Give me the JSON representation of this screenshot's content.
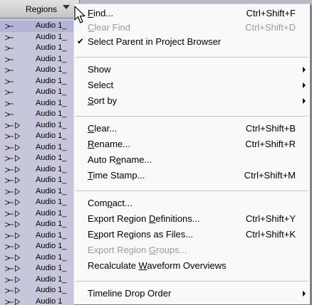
{
  "regions_panel": {
    "header_label": "Regions",
    "rows": [
      {
        "label": "Audio 1_",
        "selected": true
      },
      {
        "label": "Audio 1_",
        "selected": false
      },
      {
        "label": "Audio 1_",
        "selected": false
      },
      {
        "label": "Audio 1_",
        "selected": false
      },
      {
        "label": "Audio 1_",
        "selected": false
      },
      {
        "label": "Audio 1_",
        "selected": false
      },
      {
        "label": "Audio 1_",
        "selected": false
      },
      {
        "label": "Audio 1_",
        "selected": false
      },
      {
        "label": "Audio 1_",
        "selected": false
      },
      {
        "label": "Audio 1_",
        "selected": false
      },
      {
        "label": "Audio 1_",
        "selected": false
      },
      {
        "label": "Audio 1_",
        "selected": false
      },
      {
        "label": "Audio 1_",
        "selected": false
      },
      {
        "label": "Audio 1_",
        "selected": false
      },
      {
        "label": "Audio 1_",
        "selected": false
      },
      {
        "label": "Audio 1_",
        "selected": false
      },
      {
        "label": "Audio 1_",
        "selected": false
      },
      {
        "label": "Audio 1_",
        "selected": false
      },
      {
        "label": "Audio 1_",
        "selected": false
      },
      {
        "label": "Audio 1_",
        "selected": false
      },
      {
        "label": "Audio 1_",
        "selected": false
      },
      {
        "label": "Audio 1_",
        "selected": false
      },
      {
        "label": "Audio 1_",
        "selected": false
      },
      {
        "label": "Audio 1_",
        "selected": false
      },
      {
        "label": "Audio 1_",
        "selected": false
      },
      {
        "label": "Audio 1",
        "selected": false
      }
    ]
  },
  "menu": {
    "find": {
      "pre": "",
      "u": "F",
      "post": "ind...",
      "shortcut": "Ctrl+Shift+F"
    },
    "clear_find": {
      "pre": "",
      "u": "C",
      "post": "lear Find",
      "shortcut": "Ctrl+Shift+D"
    },
    "select_parent": {
      "check": "✔",
      "label": "Select Parent in Project Browser"
    },
    "show": {
      "label": "Show"
    },
    "select": {
      "label": "Select"
    },
    "sort_by": {
      "pre": "",
      "u": "S",
      "post": "ort by"
    },
    "clear": {
      "pre": "",
      "u": "C",
      "post": "lear...",
      "shortcut": "Ctrl+Shift+B"
    },
    "rename": {
      "pre": "",
      "u": "R",
      "post": "ename...",
      "shortcut": "Ctrl+Shift+R"
    },
    "auto_rename": {
      "pre": "Auto R",
      "u": "e",
      "post": "name..."
    },
    "time_stamp": {
      "pre": "",
      "u": "T",
      "post": "ime Stamp...",
      "shortcut": "Ctrl+Shift+M"
    },
    "compact": {
      "pre": "Com",
      "u": "p",
      "post": "act..."
    },
    "export_defs": {
      "pre": "Export Region ",
      "u": "D",
      "post": "efinitions...",
      "shortcut": "Ctrl+Shift+Y"
    },
    "export_files": {
      "pre": "E",
      "u": "x",
      "post": "port Regions as Files...",
      "shortcut": "Ctrl+Shift+K"
    },
    "export_groups": {
      "pre": "Export Region ",
      "u": "G",
      "post": "roups..."
    },
    "recalculate": {
      "pre": "Recalculate ",
      "u": "W",
      "post": "aveform Overviews"
    },
    "timeline_drop": {
      "label": "Timeline Drop Order"
    }
  },
  "colors": {
    "menu_bg": "#f9f9f9",
    "disabled_text": "#9a9a9a",
    "list_bg": "#c7c7dc",
    "list_selected": "#b4b4d6"
  }
}
